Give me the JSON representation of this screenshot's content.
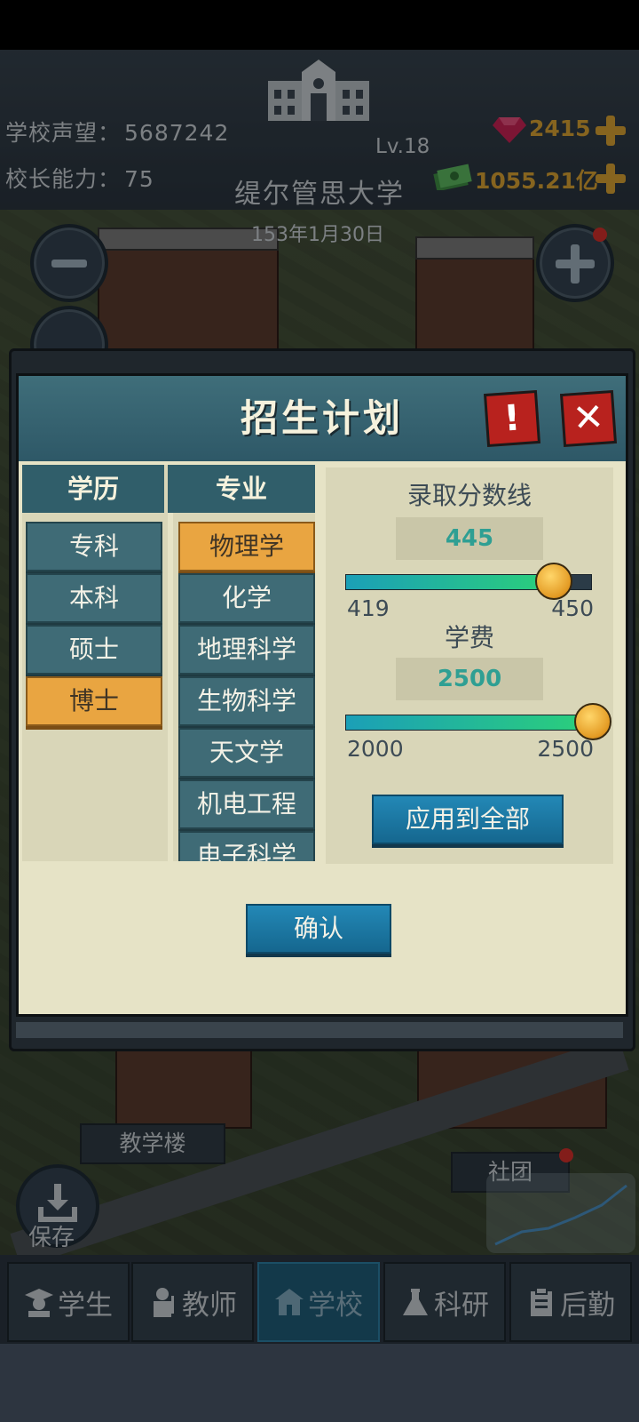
{
  "hud": {
    "reputation_label": "学校声望：",
    "reputation_value": "5687242",
    "ability_label": "校长能力：",
    "ability_value": "75",
    "level": "Lv.18",
    "school_name": "缇尔管思大学",
    "gems": "2415",
    "money": "1055.21亿",
    "date": "153年1月30日"
  },
  "scene": {
    "building_label": "教学楼",
    "club_label": "社团",
    "save_label": "保存"
  },
  "tabs": [
    {
      "label": "学生",
      "icon": "student-icon"
    },
    {
      "label": "教师",
      "icon": "teacher-icon"
    },
    {
      "label": "学校",
      "icon": "school-icon",
      "active": true
    },
    {
      "label": "科研",
      "icon": "flask-icon"
    },
    {
      "label": "后勤",
      "icon": "clipboard-icon"
    }
  ],
  "modal": {
    "title": "招生计划",
    "hint_glyph": "!",
    "close_glyph": "✕",
    "degree_header": "学历",
    "major_header": "专业",
    "degrees": [
      "专科",
      "本科",
      "硕士",
      "博士"
    ],
    "selected_degree": "博士",
    "majors": [
      "物理学",
      "化学",
      "地理科学",
      "生物科学",
      "天文学",
      "机电工程",
      "电子科学"
    ],
    "selected_major": "物理学",
    "score_label": "录取分数线",
    "score_value": "445",
    "score_min": "419",
    "score_max": "450",
    "score_fraction": 0.839,
    "fee_label": "学费",
    "fee_value": "2500",
    "fee_min": "2000",
    "fee_max": "2500",
    "fee_fraction": 1.0,
    "apply_all": "应用到全部",
    "confirm": "确认"
  },
  "colors": {
    "accent_orange": "#e9a541",
    "teal_value": "#2f9f93",
    "button_blue": "#1b7aa3",
    "close_red": "#b8221e"
  }
}
